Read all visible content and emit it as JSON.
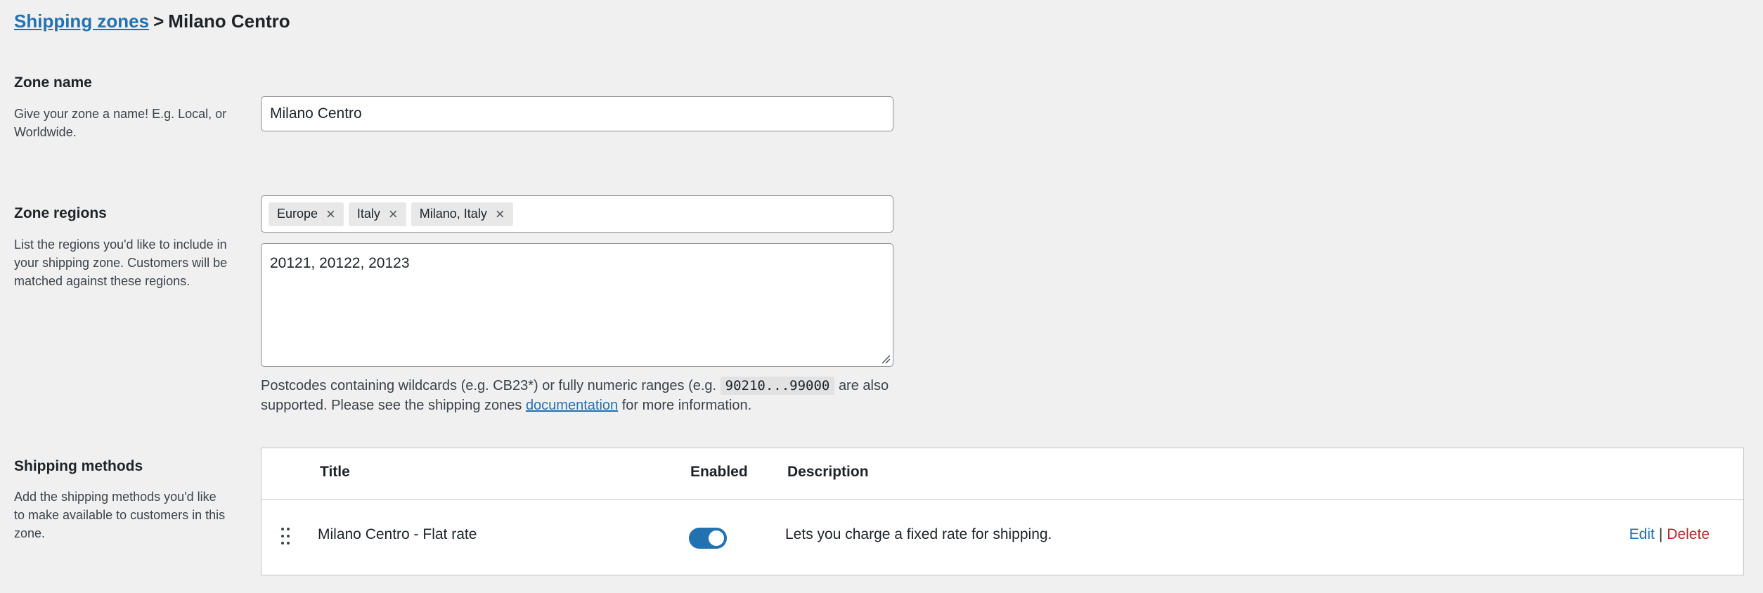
{
  "breadcrumb": {
    "parent_link": "Shipping zones",
    "separator": ">",
    "current": "Milano Centro"
  },
  "zone_name": {
    "title": "Zone name",
    "description": "Give your zone a name! E.g. Local, or Worldwide.",
    "value": "Milano Centro"
  },
  "zone_regions": {
    "title": "Zone regions",
    "description": "List the regions you'd like to include in your shipping zone. Customers will be matched against these regions.",
    "chips": [
      "Europe",
      "Italy",
      "Milano, Italy"
    ],
    "postcodes": "20121, 20122, 20123",
    "help_before": "Postcodes containing wildcards (e.g. CB23*) or fully numeric ranges (e.g.",
    "help_code": "90210...99000",
    "help_middle": "are also supported. Please see the shipping zones",
    "help_link": "documentation",
    "help_after": "for more information."
  },
  "shipping_methods": {
    "title": "Shipping methods",
    "description": "Add the shipping methods you'd like to make available to customers in this zone.",
    "columns": {
      "title": "Title",
      "enabled": "Enabled",
      "description": "Description"
    },
    "rows": [
      {
        "title": "Milano Centro - Flat rate",
        "enabled": true,
        "description": "Lets you charge a fixed rate for shipping.",
        "edit_label": "Edit",
        "separator": "|",
        "delete_label": "Delete"
      }
    ]
  },
  "colors": {
    "link": "#2271b1",
    "toggle_on": "#2271b1",
    "delete": "#b32d2e",
    "background": "#f0f0f1"
  },
  "icons": {
    "chip_remove": "close-icon",
    "drag": "drag-handle-icon",
    "resize": "resize-grip-icon"
  }
}
